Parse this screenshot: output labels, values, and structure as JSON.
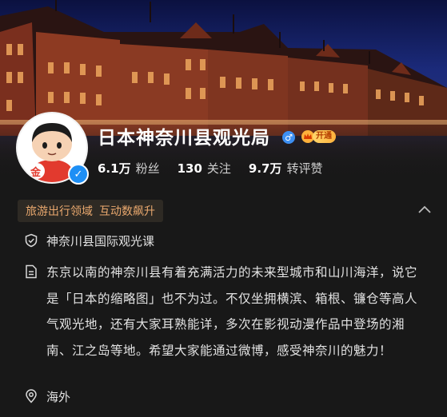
{
  "profile": {
    "name": "日本神奈川县观光局",
    "gender_symbol": "♂",
    "vip_label": "开通",
    "verified_symbol": "✓",
    "avatar_badge": "金"
  },
  "stats": [
    {
      "value": "6.1万",
      "label": "粉丝"
    },
    {
      "value": "130",
      "label": "关注"
    },
    {
      "value": "9.7万",
      "label": "转评赞"
    }
  ],
  "tags": [
    "旅游出行领域",
    "互动数飙升"
  ],
  "info": {
    "organization": "神奈川县国际观光课",
    "description": "东京以南的神奈川县有着充满活力的未来型城市和山川海洋，说它是「日本的缩略图」也不为过。不仅坐拥横滨、箱根、镰仓等高人气观光地，还有大家耳熟能详，多次在影视动漫作品中登场的湘南、江之岛等地。希望大家能通过微博，感受神奈川的魅力！",
    "location": "海外"
  },
  "icons": {
    "organization": "shield-check-icon",
    "description": "document-icon",
    "location": "location-pin-icon",
    "collapse": "chevron-up-icon"
  },
  "colors": {
    "background": "#181818",
    "tag_text": "#e9a86e",
    "verified_blue": "#1e8ff5",
    "vip_gold": "#ffb13b"
  }
}
